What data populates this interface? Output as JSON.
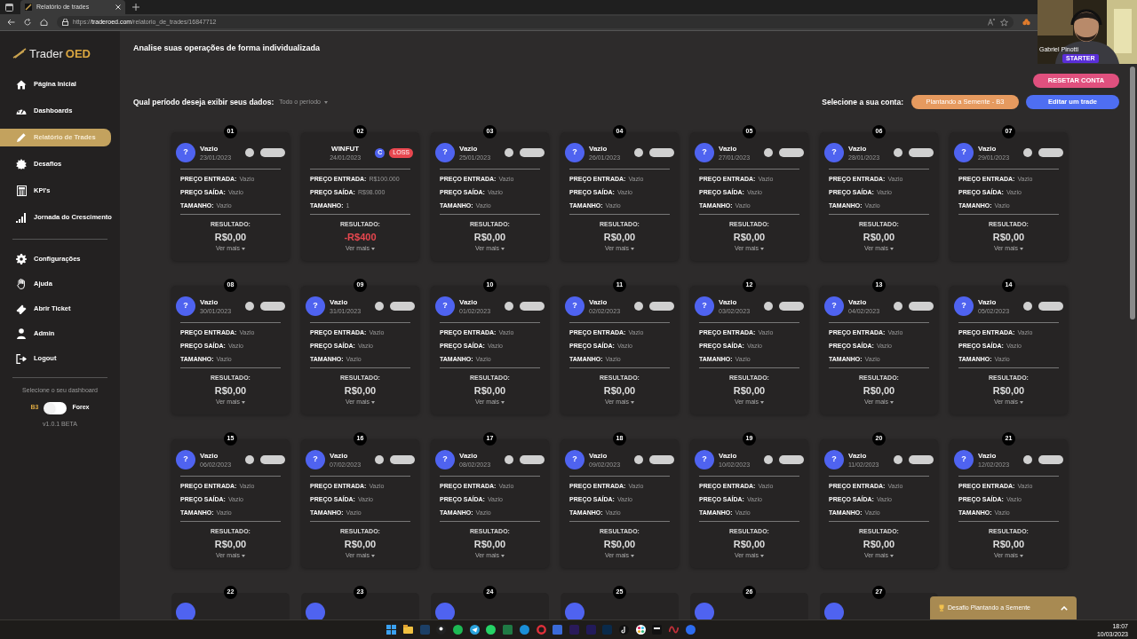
{
  "browser": {
    "tab_title": "Relatório de trades",
    "url_scheme": "https://",
    "url_host": "traderoed.com",
    "url_path": "/relatorio_de_trades/16847712"
  },
  "webcam": {
    "kind": "picture",
    "name": "Gabriel Pinotti",
    "badge": "STARTER"
  },
  "sidebar": {
    "logo_left": "Trader",
    "logo_right": "OED",
    "items": [
      {
        "label": "Página Inicial",
        "selected": false
      },
      {
        "label": "Dashboards",
        "selected": false
      },
      {
        "label": "Relatório de Trades",
        "selected": true
      },
      {
        "label": "Desafios",
        "selected": false
      },
      {
        "label": "KPI's",
        "selected": false
      },
      {
        "label": "Jornada do Crescimento",
        "selected": false
      }
    ],
    "secondary_items": [
      {
        "label": "Configurações"
      },
      {
        "label": "Ajuda"
      },
      {
        "label": "Abrir Ticket"
      },
      {
        "label": "Admin"
      },
      {
        "label": "Logout"
      }
    ],
    "dashboard_label": "Selecione o seu dashboard",
    "toggle_left": "B3",
    "toggle_right": "Forex",
    "toggle_on": false,
    "version": "v1.0.1 BETA"
  },
  "header": {
    "title": "Analise suas operações de forma individualizada",
    "reset_button": "RESETAR CONTA",
    "period_label": "Qual período deseja exibir seus dados:",
    "period_value": "Todo o período",
    "account_label": "Selecione a sua conta:",
    "account_button": "Plantando a Semente - B3",
    "edit_button": "Editar um trade"
  },
  "cards": [
    {
      "number": "01",
      "kind": "empty",
      "avatar": "?",
      "title": "Vazio",
      "date": "23/01/2023",
      "fields": [
        {
          "label": "PREÇO ENTRADA:",
          "value": "Vazio"
        },
        {
          "label": "PREÇO SAÍDA:",
          "value": "Vazio"
        },
        {
          "label": "TAMANHO:",
          "value": "Vazio"
        }
      ],
      "result_label": "RESULTADO:",
      "result": "R$0,00",
      "negative": false,
      "more": "Ver mais"
    },
    {
      "number": "02",
      "kind": "trade",
      "title": "WINFUT",
      "date": "24/01/2023",
      "side": "C",
      "tag": "LOSS",
      "fields": [
        {
          "label": "PREÇO ENTRADA:",
          "value": "R$100.000"
        },
        {
          "label": "PREÇO SAÍDA:",
          "value": "R$98.000"
        },
        {
          "label": "TAMANHO:",
          "value": "1"
        }
      ],
      "result_label": "RESULTADO:",
      "result": "-R$400",
      "negative": true,
      "more": "Ver mais"
    },
    {
      "number": "03",
      "kind": "empty",
      "avatar": "?",
      "title": "Vazio",
      "date": "25/01/2023",
      "fields": [
        {
          "label": "PREÇO ENTRADA:",
          "value": "Vazio"
        },
        {
          "label": "PREÇO SAÍDA:",
          "value": "Vazio"
        },
        {
          "label": "TAMANHO:",
          "value": "Vazio"
        }
      ],
      "result_label": "RESULTADO:",
      "result": "R$0,00",
      "negative": false,
      "more": "Ver mais"
    },
    {
      "number": "04",
      "kind": "empty",
      "avatar": "?",
      "title": "Vazio",
      "date": "26/01/2023",
      "fields": [
        {
          "label": "PREÇO ENTRADA:",
          "value": "Vazio"
        },
        {
          "label": "PREÇO SAÍDA:",
          "value": "Vazio"
        },
        {
          "label": "TAMANHO:",
          "value": "Vazio"
        }
      ],
      "result_label": "RESULTADO:",
      "result": "R$0,00",
      "negative": false,
      "more": "Ver mais"
    },
    {
      "number": "05",
      "kind": "empty",
      "avatar": "?",
      "title": "Vazio",
      "date": "27/01/2023",
      "fields": [
        {
          "label": "PREÇO ENTRADA:",
          "value": "Vazio"
        },
        {
          "label": "PREÇO SAÍDA:",
          "value": "Vazio"
        },
        {
          "label": "TAMANHO:",
          "value": "Vazio"
        }
      ],
      "result_label": "RESULTADO:",
      "result": "R$0,00",
      "negative": false,
      "more": "Ver mais"
    },
    {
      "number": "06",
      "kind": "empty",
      "avatar": "?",
      "title": "Vazio",
      "date": "28/01/2023",
      "fields": [
        {
          "label": "PREÇO ENTRADA:",
          "value": "Vazio"
        },
        {
          "label": "PREÇO SAÍDA:",
          "value": "Vazio"
        },
        {
          "label": "TAMANHO:",
          "value": "Vazio"
        }
      ],
      "result_label": "RESULTADO:",
      "result": "R$0,00",
      "negative": false,
      "more": "Ver mais"
    },
    {
      "number": "07",
      "kind": "empty",
      "avatar": "?",
      "title": "Vazio",
      "date": "29/01/2023",
      "fields": [
        {
          "label": "PREÇO ENTRADA:",
          "value": "Vazio"
        },
        {
          "label": "PREÇO SAÍDA:",
          "value": "Vazio"
        },
        {
          "label": "TAMANHO:",
          "value": "Vazio"
        }
      ],
      "result_label": "RESULTADO:",
      "result": "R$0,00",
      "negative": false,
      "more": "Ver mais"
    },
    {
      "number": "08",
      "kind": "empty",
      "avatar": "?",
      "title": "Vazio",
      "date": "30/01/2023",
      "fields": [
        {
          "label": "PREÇO ENTRADA:",
          "value": "Vazio"
        },
        {
          "label": "PREÇO SAÍDA:",
          "value": "Vazio"
        },
        {
          "label": "TAMANHO:",
          "value": "Vazio"
        }
      ],
      "result_label": "RESULTADO:",
      "result": "R$0,00",
      "negative": false,
      "more": "Ver mais"
    },
    {
      "number": "09",
      "kind": "empty",
      "avatar": "?",
      "title": "Vazio",
      "date": "31/01/2023",
      "fields": [
        {
          "label": "PREÇO ENTRADA:",
          "value": "Vazio"
        },
        {
          "label": "PREÇO SAÍDA:",
          "value": "Vazio"
        },
        {
          "label": "TAMANHO:",
          "value": "Vazio"
        }
      ],
      "result_label": "RESULTADO:",
      "result": "R$0,00",
      "negative": false,
      "more": "Ver mais"
    },
    {
      "number": "10",
      "kind": "empty",
      "avatar": "?",
      "title": "Vazio",
      "date": "01/02/2023",
      "fields": [
        {
          "label": "PREÇO ENTRADA:",
          "value": "Vazio"
        },
        {
          "label": "PREÇO SAÍDA:",
          "value": "Vazio"
        },
        {
          "label": "TAMANHO:",
          "value": "Vazio"
        }
      ],
      "result_label": "RESULTADO:",
      "result": "R$0,00",
      "negative": false,
      "more": "Ver mais"
    },
    {
      "number": "11",
      "kind": "empty",
      "avatar": "?",
      "title": "Vazio",
      "date": "02/02/2023",
      "fields": [
        {
          "label": "PREÇO ENTRADA:",
          "value": "Vazio"
        },
        {
          "label": "PREÇO SAÍDA:",
          "value": "Vazio"
        },
        {
          "label": "TAMANHO:",
          "value": "Vazio"
        }
      ],
      "result_label": "RESULTADO:",
      "result": "R$0,00",
      "negative": false,
      "more": "Ver mais"
    },
    {
      "number": "12",
      "kind": "empty",
      "avatar": "?",
      "title": "Vazio",
      "date": "03/02/2023",
      "fields": [
        {
          "label": "PREÇO ENTRADA:",
          "value": "Vazio"
        },
        {
          "label": "PREÇO SAÍDA:",
          "value": "Vazio"
        },
        {
          "label": "TAMANHO:",
          "value": "Vazio"
        }
      ],
      "result_label": "RESULTADO:",
      "result": "R$0,00",
      "negative": false,
      "more": "Ver mais"
    },
    {
      "number": "13",
      "kind": "empty",
      "avatar": "?",
      "title": "Vazio",
      "date": "04/02/2023",
      "fields": [
        {
          "label": "PREÇO ENTRADA:",
          "value": "Vazio"
        },
        {
          "label": "PREÇO SAÍDA:",
          "value": "Vazio"
        },
        {
          "label": "TAMANHO:",
          "value": "Vazio"
        }
      ],
      "result_label": "RESULTADO:",
      "result": "R$0,00",
      "negative": false,
      "more": "Ver mais"
    },
    {
      "number": "14",
      "kind": "empty",
      "avatar": "?",
      "title": "Vazio",
      "date": "05/02/2023",
      "fields": [
        {
          "label": "PREÇO ENTRADA:",
          "value": "Vazio"
        },
        {
          "label": "PREÇO SAÍDA:",
          "value": "Vazio"
        },
        {
          "label": "TAMANHO:",
          "value": "Vazio"
        }
      ],
      "result_label": "RESULTADO:",
      "result": "R$0,00",
      "negative": false,
      "more": "Ver mais"
    },
    {
      "number": "15",
      "kind": "empty",
      "avatar": "?",
      "title": "Vazio",
      "date": "06/02/2023",
      "fields": [
        {
          "label": "PREÇO ENTRADA:",
          "value": "Vazio"
        },
        {
          "label": "PREÇO SAÍDA:",
          "value": "Vazio"
        },
        {
          "label": "TAMANHO:",
          "value": "Vazio"
        }
      ],
      "result_label": "RESULTADO:",
      "result": "R$0,00",
      "negative": false,
      "more": "Ver mais"
    },
    {
      "number": "16",
      "kind": "empty",
      "avatar": "?",
      "title": "Vazio",
      "date": "07/02/2023",
      "fields": [
        {
          "label": "PREÇO ENTRADA:",
          "value": "Vazio"
        },
        {
          "label": "PREÇO SAÍDA:",
          "value": "Vazio"
        },
        {
          "label": "TAMANHO:",
          "value": "Vazio"
        }
      ],
      "result_label": "RESULTADO:",
      "result": "R$0,00",
      "negative": false,
      "more": "Ver mais"
    },
    {
      "number": "17",
      "kind": "empty",
      "avatar": "?",
      "title": "Vazio",
      "date": "08/02/2023",
      "fields": [
        {
          "label": "PREÇO ENTRADA:",
          "value": "Vazio"
        },
        {
          "label": "PREÇO SAÍDA:",
          "value": "Vazio"
        },
        {
          "label": "TAMANHO:",
          "value": "Vazio"
        }
      ],
      "result_label": "RESULTADO:",
      "result": "R$0,00",
      "negative": false,
      "more": "Ver mais"
    },
    {
      "number": "18",
      "kind": "empty",
      "avatar": "?",
      "title": "Vazio",
      "date": "09/02/2023",
      "fields": [
        {
          "label": "PREÇO ENTRADA:",
          "value": "Vazio"
        },
        {
          "label": "PREÇO SAÍDA:",
          "value": "Vazio"
        },
        {
          "label": "TAMANHO:",
          "value": "Vazio"
        }
      ],
      "result_label": "RESULTADO:",
      "result": "R$0,00",
      "negative": false,
      "more": "Ver mais"
    },
    {
      "number": "19",
      "kind": "empty",
      "avatar": "?",
      "title": "Vazio",
      "date": "10/02/2023",
      "fields": [
        {
          "label": "PREÇO ENTRADA:",
          "value": "Vazio"
        },
        {
          "label": "PREÇO SAÍDA:",
          "value": "Vazio"
        },
        {
          "label": "TAMANHO:",
          "value": "Vazio"
        }
      ],
      "result_label": "RESULTADO:",
      "result": "R$0,00",
      "negative": false,
      "more": "Ver mais"
    },
    {
      "number": "20",
      "kind": "empty",
      "avatar": "?",
      "title": "Vazio",
      "date": "11/02/2023",
      "fields": [
        {
          "label": "PREÇO ENTRADA:",
          "value": "Vazio"
        },
        {
          "label": "PREÇO SAÍDA:",
          "value": "Vazio"
        },
        {
          "label": "TAMANHO:",
          "value": "Vazio"
        }
      ],
      "result_label": "RESULTADO:",
      "result": "R$0,00",
      "negative": false,
      "more": "Ver mais"
    },
    {
      "number": "21",
      "kind": "empty",
      "avatar": "?",
      "title": "Vazio",
      "date": "12/02/2023",
      "fields": [
        {
          "label": "PREÇO ENTRADA:",
          "value": "Vazio"
        },
        {
          "label": "PREÇO SAÍDA:",
          "value": "Vazio"
        },
        {
          "label": "TAMANHO:",
          "value": "Vazio"
        }
      ],
      "result_label": "RESULTADO:",
      "result": "R$0,00",
      "negative": false,
      "more": "Ver mais"
    }
  ],
  "partial_cards": [
    {
      "number": "22"
    },
    {
      "number": "23"
    },
    {
      "number": "24"
    },
    {
      "number": "25"
    },
    {
      "number": "26"
    },
    {
      "number": "27"
    }
  ],
  "challenge_popup": {
    "label": "Desafio Plantando a Semente"
  },
  "taskbar": {
    "time": "18:07",
    "date": "10/03/2023"
  }
}
